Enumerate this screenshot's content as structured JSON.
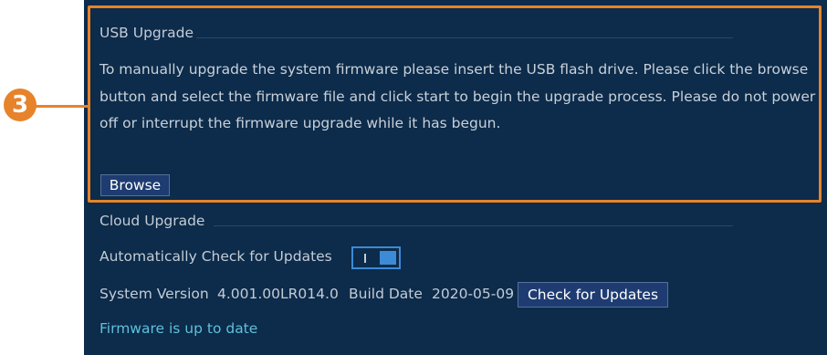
{
  "usb_upgrade": {
    "title": "USB Upgrade",
    "description": "To manually upgrade the system firmware please insert the USB flash drive. Please click the browse button and select the firmware file and click start to begin the upgrade process. Please do not power off or interrupt the firmware upgrade while it has begun.",
    "browse_label": "Browse"
  },
  "callout": {
    "number": "3",
    "color": "#e6832b"
  },
  "cloud_upgrade": {
    "title": "Cloud Upgrade",
    "auto_check_label": "Automatically Check for Updates",
    "auto_check_enabled": true,
    "system_version_label": "System Version",
    "system_version_value": "4.001.00LR014.0",
    "build_date_label": "Build Date",
    "build_date_value": "2020-05-09",
    "check_button_label": "Check for Updates",
    "status_text": "Firmware is up to date"
  },
  "colors": {
    "panel_bg": "#0d2b4a",
    "accent": "#3d8bd6",
    "button_bg": "#1e3c71",
    "status_text": "#5ec0dc"
  }
}
